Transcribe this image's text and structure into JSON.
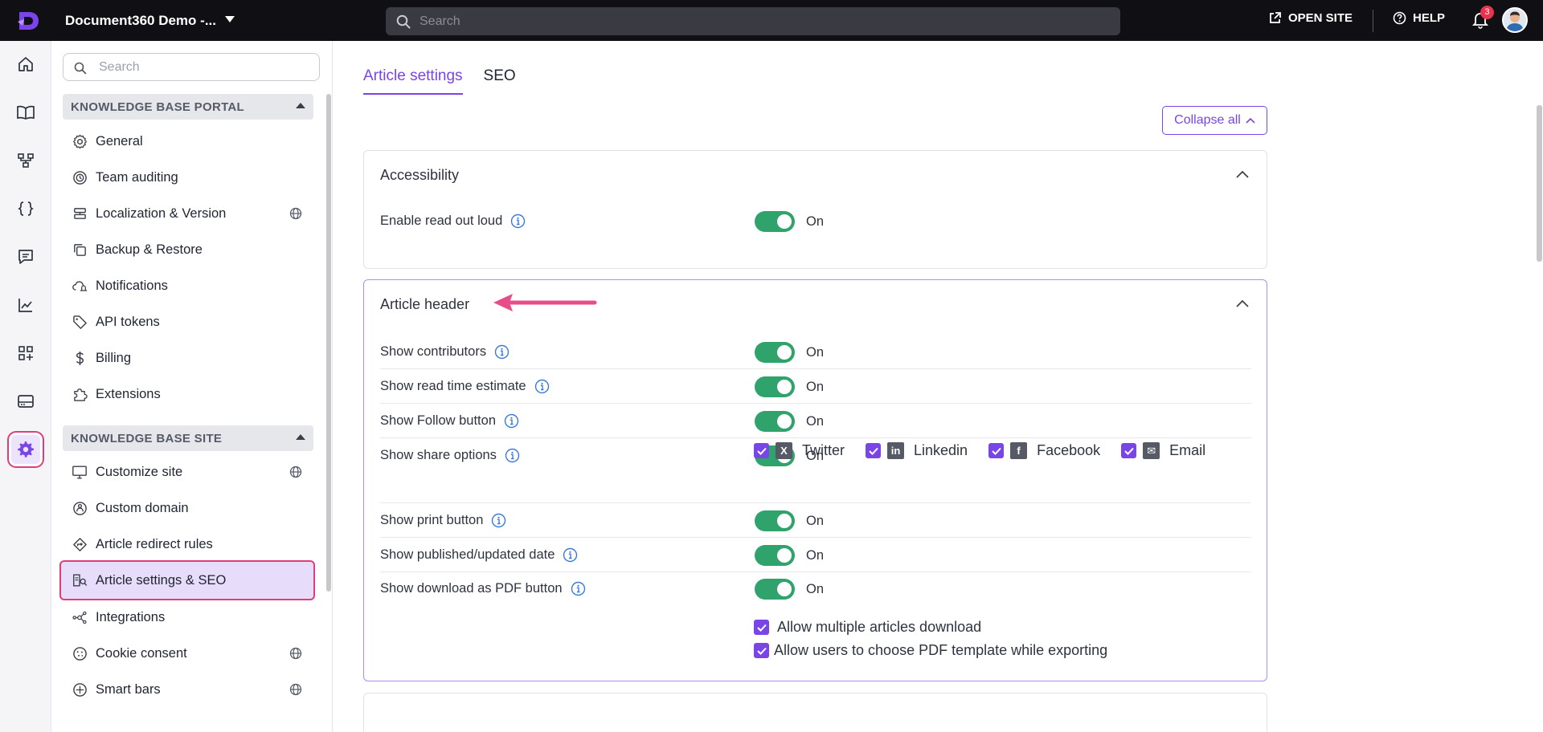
{
  "topbar": {
    "project_title": "Document360 Demo -...",
    "search_placeholder": "Search",
    "open_site_label": "OPEN SITE",
    "help_label": "HELP",
    "notification_count": "3"
  },
  "rail": {
    "items": [
      "home-icon",
      "book-icon",
      "hierarchy-icon",
      "braces-icon",
      "comment-icon",
      "analytics-icon",
      "apps-add-icon",
      "drive-icon",
      "gear-icon"
    ],
    "active": "gear-icon"
  },
  "nav": {
    "search_placeholder": "Search",
    "groups": [
      {
        "title": "KNOWLEDGE BASE PORTAL",
        "items": [
          {
            "label": "General",
            "icon": "gear-icon"
          },
          {
            "label": "Team auditing",
            "icon": "audit-icon"
          },
          {
            "label": "Localization & Version",
            "icon": "layers-icon",
            "globe": true
          },
          {
            "label": "Backup & Restore",
            "icon": "copy-icon"
          },
          {
            "label": "Notifications",
            "icon": "cloud-bell-icon"
          },
          {
            "label": "API tokens",
            "icon": "tag-icon"
          },
          {
            "label": "Billing",
            "icon": "dollar-icon"
          },
          {
            "label": "Extensions",
            "icon": "puzzle-icon"
          }
        ]
      },
      {
        "title": "KNOWLEDGE BASE SITE",
        "items": [
          {
            "label": "Customize site",
            "icon": "monitor-icon",
            "globe": true
          },
          {
            "label": "Custom domain",
            "icon": "domain-icon"
          },
          {
            "label": "Article redirect rules",
            "icon": "redirect-icon"
          },
          {
            "label": "Article settings & SEO",
            "icon": "article-seo-icon",
            "active": true
          },
          {
            "label": "Integrations",
            "icon": "integrations-icon"
          },
          {
            "label": "Cookie consent",
            "icon": "cookie-icon",
            "globe": true
          },
          {
            "label": "Smart bars",
            "icon": "smartbar-icon",
            "globe": true
          }
        ]
      }
    ]
  },
  "main": {
    "tabs": [
      {
        "label": "Article settings",
        "active": true
      },
      {
        "label": "SEO",
        "active": false
      }
    ],
    "collapse_all_label": "Collapse all",
    "sections": [
      {
        "title": "Accessibility",
        "rows": [
          {
            "label": "Enable read out loud",
            "state": "On"
          }
        ]
      },
      {
        "title": "Article header",
        "rows": [
          {
            "label": "Show contributors",
            "state": "On"
          },
          {
            "label": "Show read time estimate",
            "state": "On"
          },
          {
            "label": "Show Follow button",
            "state": "On"
          },
          {
            "label": "Show share options",
            "state": "On"
          },
          {
            "label": "Show print button",
            "state": "On"
          },
          {
            "label": "Show published/updated date",
            "state": "On"
          },
          {
            "label": "Show download as PDF button",
            "state": "On"
          }
        ],
        "share_options": [
          {
            "label": "Twitter",
            "icon": "x-icon",
            "glyph": "X",
            "checked": true
          },
          {
            "label": "Linkedin",
            "icon": "linkedin-icon",
            "glyph": "in",
            "checked": true
          },
          {
            "label": "Facebook",
            "icon": "facebook-icon",
            "glyph": "f",
            "checked": true
          },
          {
            "label": "Email",
            "icon": "email-icon",
            "glyph": "✉",
            "checked": true
          }
        ],
        "pdf_options": [
          {
            "label": "Allow multiple articles download",
            "checked": true
          },
          {
            "label": "Allow users to choose PDF template while exporting",
            "checked": true
          }
        ]
      }
    ]
  },
  "colors": {
    "accent": "#7a45e8",
    "toggle_on": "#2fa36b",
    "highlight": "#e03e7a",
    "topbar": "#0f0f14"
  }
}
